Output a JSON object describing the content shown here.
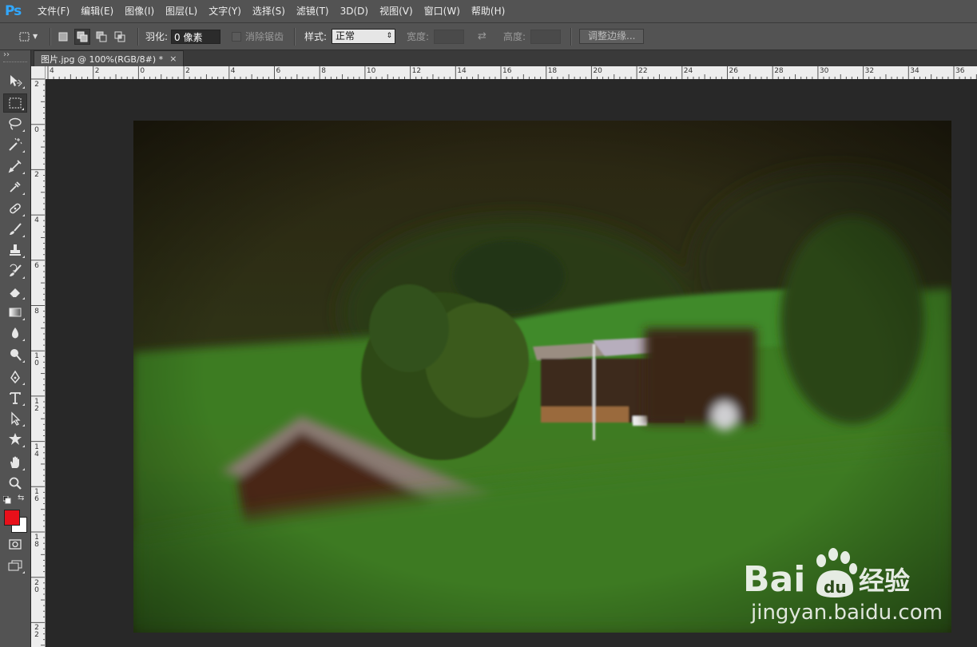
{
  "app": {
    "logo": "Ps",
    "menu": [
      "文件(F)",
      "编辑(E)",
      "图像(I)",
      "图层(L)",
      "文字(Y)",
      "选择(S)",
      "滤镜(T)",
      "3D(D)",
      "视图(V)",
      "窗口(W)",
      "帮助(H)"
    ]
  },
  "options": {
    "feather_label": "羽化:",
    "feather_value": "0 像素",
    "antialias_label": "消除锯齿",
    "style_label": "样式:",
    "style_value": "正常",
    "width_label": "宽度:",
    "height_label": "高度:",
    "refine_edge_label": "调整边缘..."
  },
  "document": {
    "tab_title": "图片.jpg @ 100%(RGB/8#) *",
    "close_glyph": "×"
  },
  "rulers": {
    "horizontal": [
      "4",
      "2",
      "0",
      "2",
      "4",
      "6",
      "8",
      "10",
      "12",
      "14",
      "16",
      "18",
      "20",
      "22",
      "24",
      "26",
      "28",
      "30",
      "32",
      "34",
      "36"
    ],
    "vertical": [
      "2",
      "0",
      "2",
      "4",
      "6",
      "8",
      "10",
      "12",
      "14",
      "16",
      "18",
      "20",
      "22"
    ]
  },
  "tools": [
    {
      "name": "move-tool",
      "active": false
    },
    {
      "name": "rectangular-marquee-tool",
      "active": true
    },
    {
      "name": "lasso-tool",
      "active": false
    },
    {
      "name": "magic-wand-tool",
      "active": false
    },
    {
      "name": "crop-tool",
      "active": false
    },
    {
      "name": "eyedropper-tool",
      "active": false
    },
    {
      "name": "spot-healing-tool",
      "active": false
    },
    {
      "name": "brush-tool",
      "active": false
    },
    {
      "name": "clone-stamp-tool",
      "active": false
    },
    {
      "name": "history-brush-tool",
      "active": false
    },
    {
      "name": "eraser-tool",
      "active": false
    },
    {
      "name": "gradient-tool",
      "active": false
    },
    {
      "name": "blur-tool",
      "active": false
    },
    {
      "name": "dodge-tool",
      "active": false
    },
    {
      "name": "pen-tool",
      "active": false
    },
    {
      "name": "type-tool",
      "active": false
    },
    {
      "name": "path-selection-tool",
      "active": false
    },
    {
      "name": "custom-shape-tool",
      "active": false
    },
    {
      "name": "hand-tool",
      "active": false
    },
    {
      "name": "zoom-tool",
      "active": false
    }
  ],
  "colors": {
    "foreground": "#e8101a",
    "background": "#ffffff",
    "ui_panel": "#535353",
    "workspace": "#282828"
  },
  "watermark": {
    "brand": "Bai",
    "brand_du": "du",
    "brand_cn": "经验",
    "url": "jingyan.baidu.com"
  }
}
